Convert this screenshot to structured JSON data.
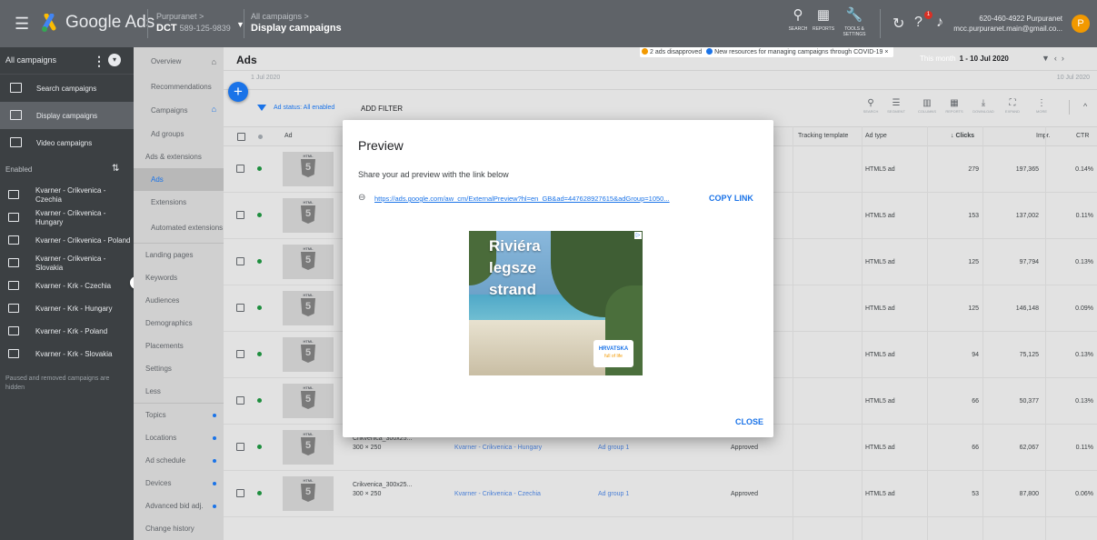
{
  "topbar": {
    "brand": "Google Ads",
    "account_crumb": "Purpuranet >",
    "account_name": "DCT",
    "account_id": "589-125-9839",
    "campaign_crumb": "All campaigns >",
    "campaign_name": "Display campaigns",
    "tools": {
      "search": "SEARCH",
      "reports": "REPORTS",
      "tools": "TOOLS & SETTINGS"
    },
    "bell_count": "1",
    "user_line1": "620-460-4922 Purpuranet",
    "user_line2": "mcc.purpuranet.main@gmail.co...",
    "avatar": "P"
  },
  "left_nav": {
    "header": "All campaigns",
    "items": [
      {
        "label": "Search campaigns"
      },
      {
        "label": "Display campaigns"
      },
      {
        "label": "Video campaigns"
      }
    ],
    "enabled_label": "Enabled",
    "campaigns": [
      {
        "label": "Kvarner - Crikvenica - Czechia"
      },
      {
        "label": "Kvarner - Crikvenica - Hungary"
      },
      {
        "label": "Kvarner - Crikvenica - Poland"
      },
      {
        "label": "Kvarner - Crikvenica - Slovakia"
      },
      {
        "label": "Kvarner - Krk - Czechia"
      },
      {
        "label": "Kvarner - Krk - Hungary"
      },
      {
        "label": "Kvarner - Krk - Poland"
      },
      {
        "label": "Kvarner - Krk - Slovakia"
      }
    ],
    "footer": "Paused and removed campaigns are hidden"
  },
  "page_nav": {
    "overview": "Overview",
    "recommendations": "Recommendations",
    "campaigns": "Campaigns",
    "ad_groups": "Ad groups",
    "ads_extensions": "Ads & extensions",
    "ads": "Ads",
    "extensions": "Extensions",
    "automated_extensions": "Automated extensions",
    "landing_pages": "Landing pages",
    "keywords": "Keywords",
    "audiences": "Audiences",
    "demographics": "Demographics",
    "placements": "Placements",
    "settings": "Settings",
    "less": "Less",
    "topics": "Topics",
    "locations": "Locations",
    "ad_schedule": "Ad schedule",
    "devices": "Devices",
    "advanced_bid": "Advanced bid adj.",
    "change_history": "Change history"
  },
  "main": {
    "title": "Ads",
    "notify_warn": "2 ads disapproved",
    "notify_info": "New resources for managing campaigns through COVID-19",
    "date_label": "This month",
    "date_range": "1 - 10 Jul 2020",
    "chart_start": "1 Jul 2020",
    "chart_end": "10 Jul 2020",
    "filter_status": "Ad status: All enabled",
    "add_filter": "ADD FILTER",
    "tools": {
      "search": "SEARCH",
      "segment": "SEGMENT",
      "columns": "COLUMNS",
      "reports": "REPORTS",
      "download": "DOWNLOAD",
      "expand": "EXPAND",
      "more": "MORE"
    }
  },
  "table": {
    "headers": {
      "ad": "Ad",
      "tracking": "Tracking template",
      "ad_type": "Ad type",
      "clicks": "Clicks",
      "impr": "Impr.",
      "ctr": "CTR"
    },
    "thumb_label": "HTML",
    "rows": [
      {
        "ad_type": "HTML5 ad",
        "clicks": "279",
        "impr": "197,365",
        "ctr": "0.14%"
      },
      {
        "ad_type": "HTML5 ad",
        "clicks": "153",
        "impr": "137,002",
        "ctr": "0.11%"
      },
      {
        "ad_type": "HTML5 ad",
        "clicks": "125",
        "impr": "97,794",
        "ctr": "0.13%"
      },
      {
        "ad_type": "HTML5 ad",
        "clicks": "125",
        "impr": "146,148",
        "ctr": "0.09%"
      },
      {
        "ad_type": "HTML5 ad",
        "clicks": "94",
        "impr": "75,125",
        "ctr": "0.13%"
      },
      {
        "ad_type": "HTML5 ad",
        "clicks": "66",
        "impr": "50,377",
        "ctr": "0.13%"
      },
      {
        "ad_name": "Crikvenica_300x25...",
        "ad_size": "300 × 250",
        "campaign": "Kvarner - Crikvenica - Hungary",
        "ad_group": "Ad group 1",
        "status": "Approved",
        "ad_type": "HTML5 ad",
        "clicks": "66",
        "impr": "62,067",
        "ctr": "0.11%"
      },
      {
        "ad_name": "Crikvenica_300x25...",
        "ad_size": "300 × 250",
        "campaign": "Kvarner - Crikvenica - Czechia",
        "ad_group": "Ad group 1",
        "status": "Approved",
        "ad_type": "HTML5 ad",
        "clicks": "53",
        "impr": "87,800",
        "ctr": "0.06%"
      }
    ]
  },
  "dialog": {
    "title": "Preview",
    "subtitle": "Share your ad preview with the link below",
    "link": "https://ads.google.com/aw_cm/ExternalPreview?hl=en_GB&ad=447628927615&adGroup=1050...",
    "copy": "COPY LINK",
    "ad_lines": [
      "Riviéra",
      "legsze",
      "strand"
    ],
    "ad_logo_top": "HRVATSKA",
    "ad_logo_bottom": "full of life",
    "close": "CLOSE"
  },
  "colors": {
    "accent": "#1a73e8",
    "topbar": "#5f6368",
    "leftnav": "#3c4043",
    "status_green": "#1e8e3e"
  }
}
